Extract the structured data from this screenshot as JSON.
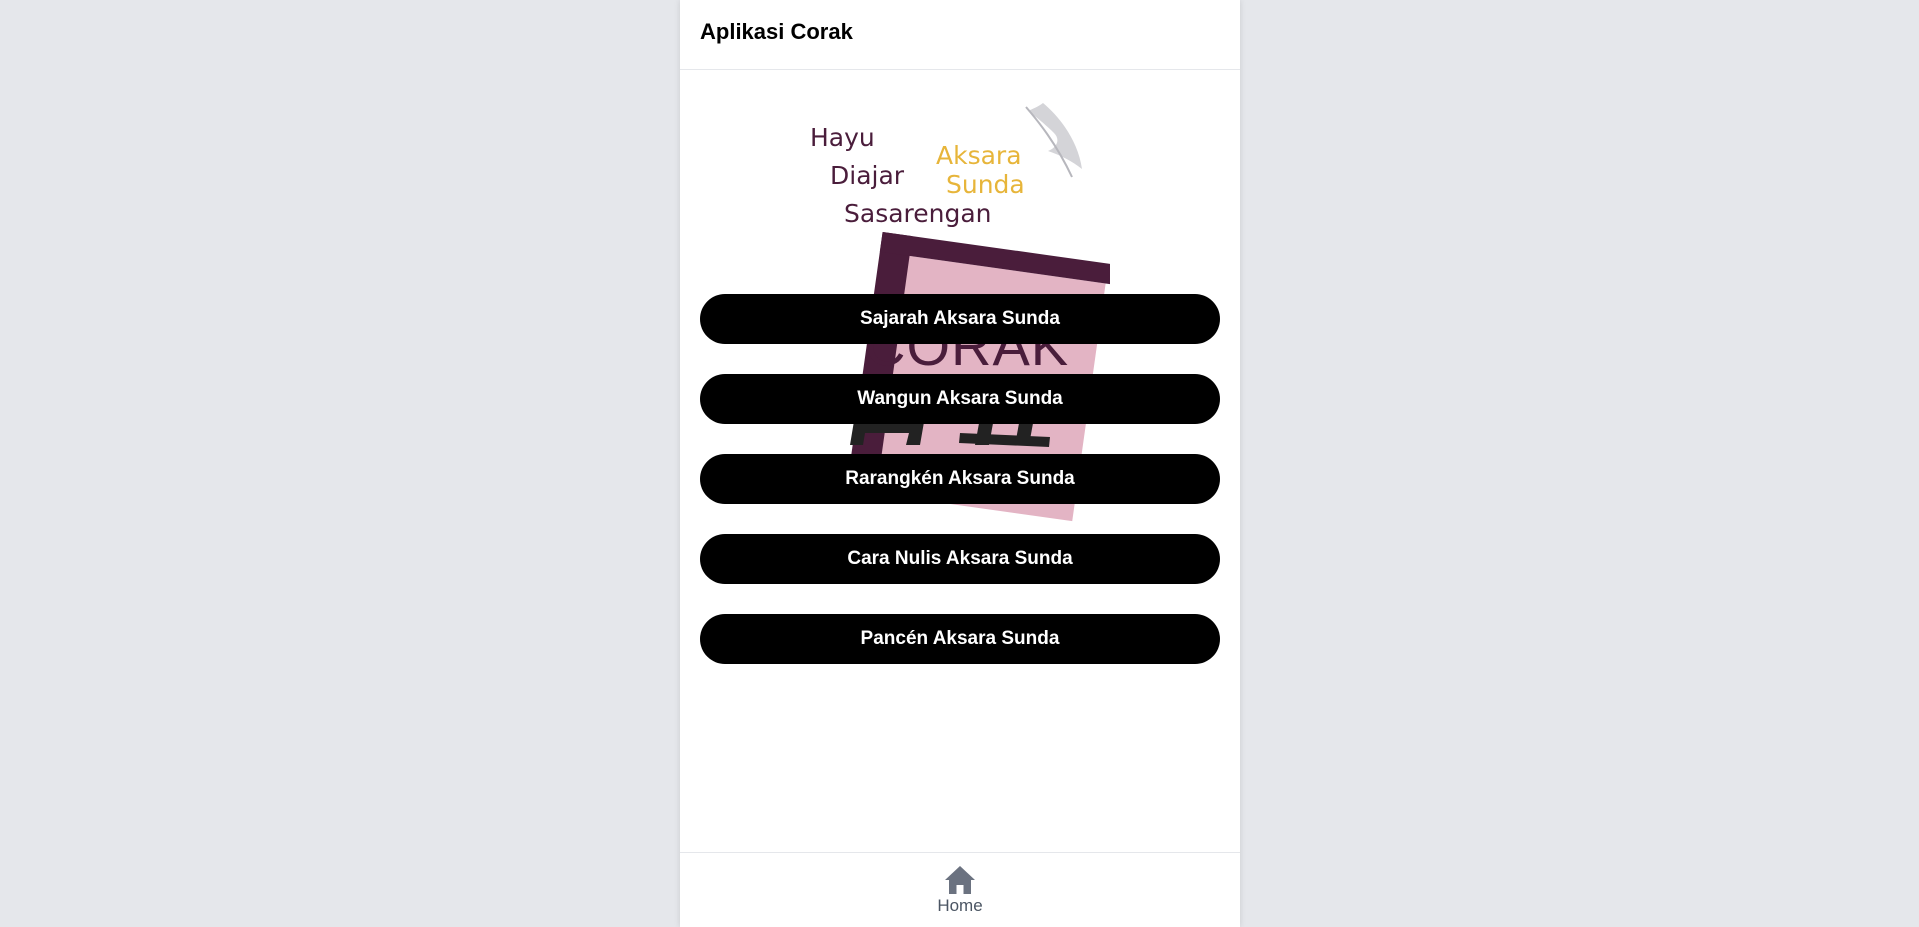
{
  "header": {
    "title": "Aplikasi Corak"
  },
  "logo": {
    "tagline_line1": "Hayu",
    "tagline_line2": "Diajar",
    "tagline_line3": "Sasarengan",
    "highlight_line1": "Aksara",
    "highlight_line2": "Sunda",
    "wordmark": "CORAK",
    "icon": "feather-quill-icon",
    "colors": {
      "dark": "#4a1d3b",
      "gold": "#e7b53a",
      "pink": "#e3b4c4"
    }
  },
  "menu": {
    "items": [
      {
        "label": "Sajarah Aksara Sunda"
      },
      {
        "label": "Wangun Aksara Sunda"
      },
      {
        "label": "Rarangkén Aksara Sunda"
      },
      {
        "label": "Cara Nulis Aksara Sunda"
      },
      {
        "label": "Pancén Aksara Sunda"
      }
    ]
  },
  "bottom_nav": {
    "home_label": "Home",
    "home_icon": "home-icon"
  }
}
